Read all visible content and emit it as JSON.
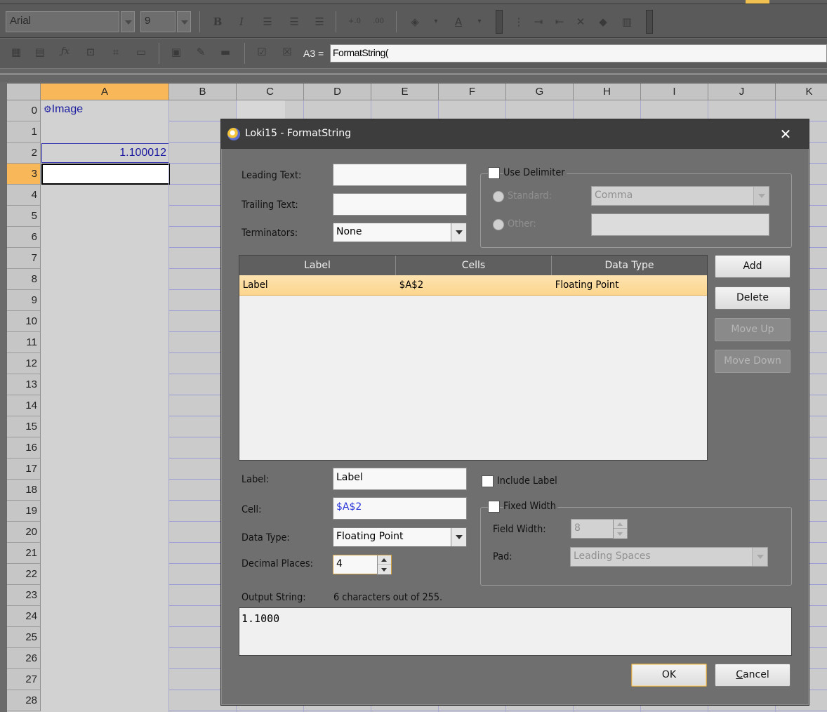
{
  "toolbar": {
    "font_name": "Arial",
    "font_size": "9",
    "bold": "B",
    "italic": "I",
    "font_color": "A",
    "cell_ref": "A3 =",
    "formula": "FormatString("
  },
  "sheet": {
    "columns": [
      "A",
      "B",
      "C",
      "D",
      "E",
      "F",
      "G",
      "H",
      "I",
      "J",
      "K"
    ],
    "rows": [
      "0",
      "1",
      "2",
      "3",
      "4",
      "5",
      "6",
      "7",
      "8",
      "9",
      "10",
      "11",
      "12",
      "13",
      "14",
      "15",
      "16",
      "17",
      "18",
      "19",
      "20",
      "21",
      "22",
      "23",
      "24",
      "25",
      "26",
      "27",
      "28"
    ],
    "selected_column": "A",
    "selected_row": "3",
    "cells": {
      "a0": "Image",
      "a2": "1.100012"
    }
  },
  "dialog": {
    "title": "Loki15 - FormatString",
    "leading_text_label": "Leading Text:",
    "leading_text_value": "",
    "trailing_text_label": "Trailing Text:",
    "trailing_text_value": "",
    "terminators_label": "Terminators:",
    "terminators_value": "None",
    "use_delimiter_label": "Use Delimiter",
    "standard_label": "Standard:",
    "standard_value": "Comma",
    "other_label": "Other:",
    "other_value": "",
    "list": {
      "columns": [
        "Label",
        "Cells",
        "Data Type"
      ],
      "rows": [
        {
          "label": "Label",
          "cells": "$A$2",
          "data_type": "Floating Point"
        }
      ]
    },
    "buttons": {
      "add": "Add",
      "delete": "Delete",
      "move_up": "Move Up",
      "move_down": "Move Down",
      "ok": "OK",
      "cancel_prefix": "",
      "cancel_mnemonic": "C",
      "cancel_rest": "ancel"
    },
    "label_label": "Label:",
    "label_value": "Label",
    "cell_label": "Cell:",
    "cell_value": "$A$2",
    "data_type_label": "Data Type:",
    "data_type_value": "Floating Point",
    "decimal_places_label": "Decimal Places:",
    "decimal_places_value": "4",
    "include_label": "Include Label",
    "fixed_width_label": "Fixed Width",
    "field_width_label": "Field Width:",
    "field_width_value": "8",
    "pad_label": "Pad:",
    "pad_value": "Leading Spaces",
    "output_string_label": "Output String:",
    "output_count": "6 characters out of 255.",
    "output_value": "1.1000"
  },
  "colors": {
    "selection": "#f8b85a",
    "cell_text_blue": "#1a1aa0",
    "title_bar": "#3d3d3d",
    "dialog_bg": "#6f6f6f"
  }
}
